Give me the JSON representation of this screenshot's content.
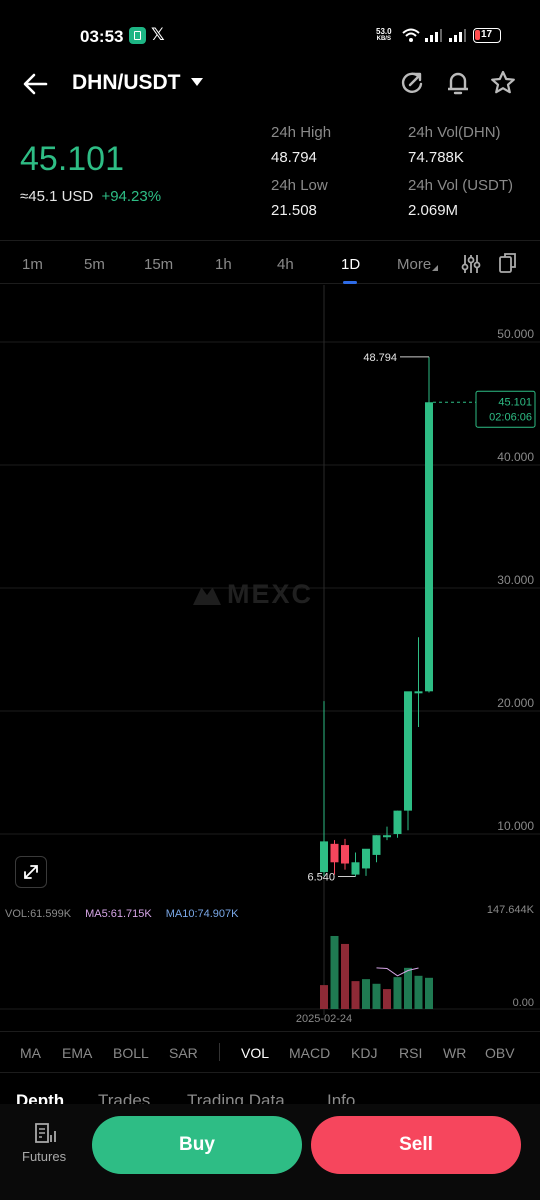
{
  "status_bar": {
    "time": "03:53",
    "x_label": "𝕏",
    "net_speed_value": "53.0",
    "net_speed_unit": "KB/S",
    "battery": "17"
  },
  "header": {
    "pair": "DHN/USDT",
    "icons": [
      "back-arrow-icon",
      "refresh-share-icon",
      "bell-icon",
      "star-icon"
    ]
  },
  "ticker": {
    "last_price": "45.101",
    "usd_value": "≈45.1 USD",
    "change_pct": "+94.23%",
    "high_label": "24h High",
    "high_value": "48.794",
    "low_label": "24h Low",
    "low_value": "21.508",
    "vol_base_label": "24h Vol(DHN)",
    "vol_base_value": "74.788K",
    "vol_quote_label": "24h Vol (USDT)",
    "vol_quote_value": "2.069M"
  },
  "timeframes": {
    "items": [
      "1m",
      "5m",
      "15m",
      "1h",
      "4h",
      "1D",
      "More"
    ],
    "active": "1D"
  },
  "chart": {
    "watermark": "MEXC",
    "price_axis": [
      "50.000",
      "40.000",
      "30.000",
      "20.000",
      "10.000"
    ],
    "high_marker": "48.794",
    "low_marker": "6.540",
    "current_price": "45.101",
    "countdown": "02:06:06",
    "vol_axis_max": "147.644K",
    "vol_axis_min": "0.00",
    "date_label": "2025-02-24",
    "vol_legend": {
      "vol": "VOL:61.599K",
      "ma5": "MA5:61.715K",
      "ma10": "MA10:74.907K"
    }
  },
  "colors": {
    "up": "#2ebd85",
    "down": "#f6465d",
    "accent": "#2e6be6"
  },
  "indicators": {
    "items": [
      "MA",
      "EMA",
      "BOLL",
      "SAR",
      "VOL",
      "MACD",
      "KDJ",
      "RSI",
      "WR",
      "OBV"
    ],
    "active": "VOL"
  },
  "tabs": {
    "items": [
      "Depth",
      "Trades",
      "Trading Data",
      "Info"
    ],
    "active": "Depth"
  },
  "bottom": {
    "futures_label": "Futures",
    "buy_label": "Buy",
    "sell_label": "Sell"
  },
  "chart_data": {
    "type": "candlestick",
    "x": [
      "d1",
      "d2",
      "d3",
      "d4",
      "d5",
      "d6",
      "d7",
      "d8",
      "d9",
      "d10",
      "d11"
    ],
    "ohlc": [
      {
        "o": 6.9,
        "h": 20.8,
        "l": 6.6,
        "c": 9.4
      },
      {
        "o": 9.2,
        "h": 9.5,
        "l": 6.7,
        "c": 7.7
      },
      {
        "o": 9.1,
        "h": 9.6,
        "l": 7.1,
        "c": 7.6
      },
      {
        "o": 6.7,
        "h": 8.5,
        "l": 6.54,
        "c": 7.7
      },
      {
        "o": 7.2,
        "h": 8.3,
        "l": 6.6,
        "c": 8.8
      },
      {
        "o": 8.3,
        "h": 9.9,
        "l": 7.7,
        "c": 9.9
      },
      {
        "o": 9.8,
        "h": 10.6,
        "l": 9.5,
        "c": 9.9
      },
      {
        "o": 10.0,
        "h": 11.9,
        "l": 9.7,
        "c": 11.9
      },
      {
        "o": 11.9,
        "h": 19.7,
        "l": 10.3,
        "c": 21.6
      },
      {
        "o": 21.6,
        "h": 26.0,
        "l": 18.7,
        "c": 21.6
      },
      {
        "o": 21.6,
        "h": 48.794,
        "l": 21.5,
        "c": 45.101
      }
    ],
    "volume": [
      {
        "v": 36000,
        "dir": "down"
      },
      {
        "v": 110000,
        "dir": "up"
      },
      {
        "v": 98000,
        "dir": "down"
      },
      {
        "v": 42000,
        "dir": "down"
      },
      {
        "v": 45000,
        "dir": "up"
      },
      {
        "v": 38000,
        "dir": "up"
      },
      {
        "v": 30000,
        "dir": "down"
      },
      {
        "v": 48000,
        "dir": "up"
      },
      {
        "v": 62000,
        "dir": "up"
      },
      {
        "v": 50000,
        "dir": "up"
      },
      {
        "v": 47000,
        "dir": "up"
      }
    ],
    "ma5_vol": [
      62000,
      61000,
      50000,
      58000,
      61715
    ],
    "ylim": [
      0,
      52
    ],
    "vol_ylim": [
      0,
      147644
    ]
  }
}
